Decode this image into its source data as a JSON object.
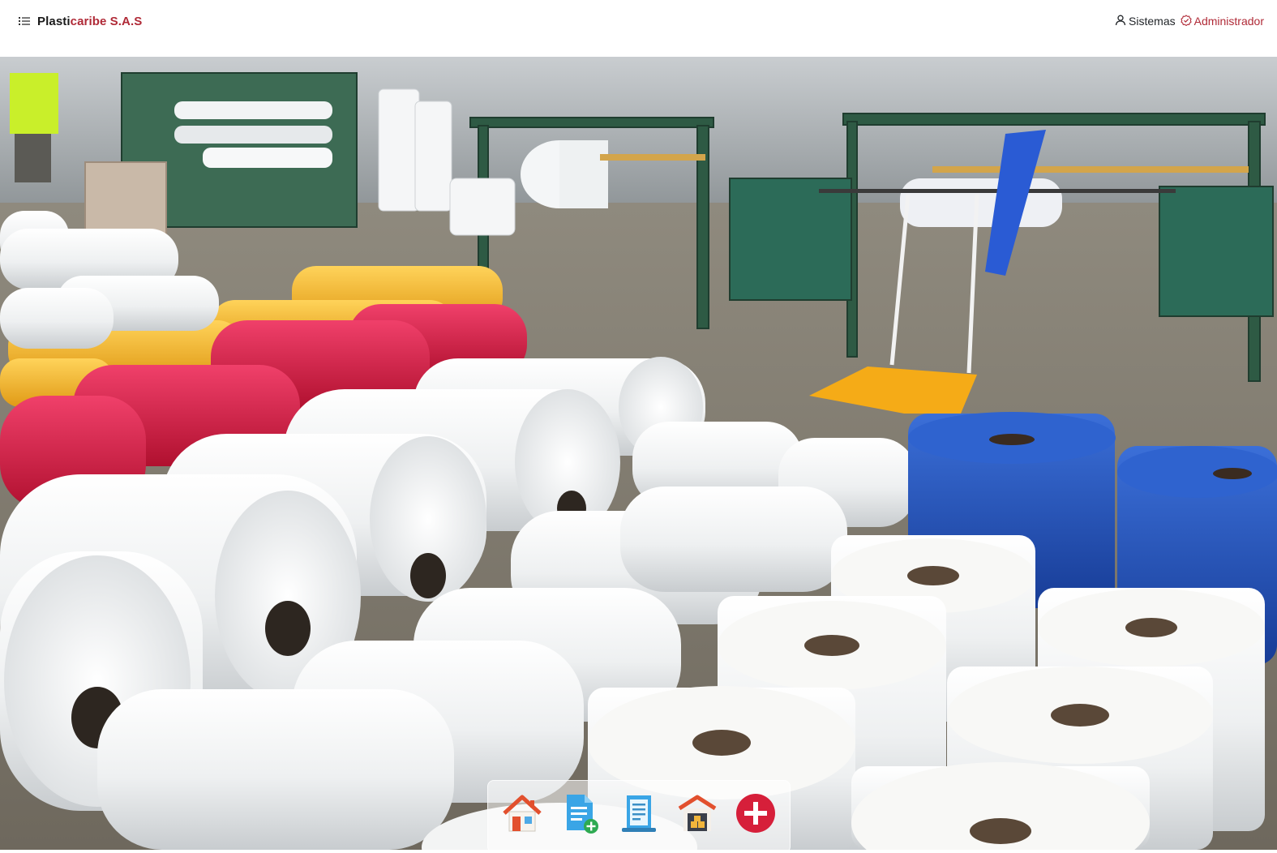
{
  "header": {
    "brand_part1": "Plasti",
    "brand_part2": "caribe S.A.S",
    "user_area_label": "Sistemas",
    "role_label": "Administrador"
  },
  "icons": {
    "menu": "list-icon",
    "user": "person-icon",
    "role": "badge-check-icon"
  },
  "colors": {
    "brand_accent": "#b02a37",
    "text_dark": "#1a1a1a"
  },
  "dock": {
    "buttons": [
      {
        "icon": "home-icon"
      },
      {
        "icon": "new-document-icon"
      },
      {
        "icon": "report-document-icon"
      },
      {
        "icon": "warehouse-icon"
      },
      {
        "icon": "add-circle-icon"
      }
    ]
  }
}
